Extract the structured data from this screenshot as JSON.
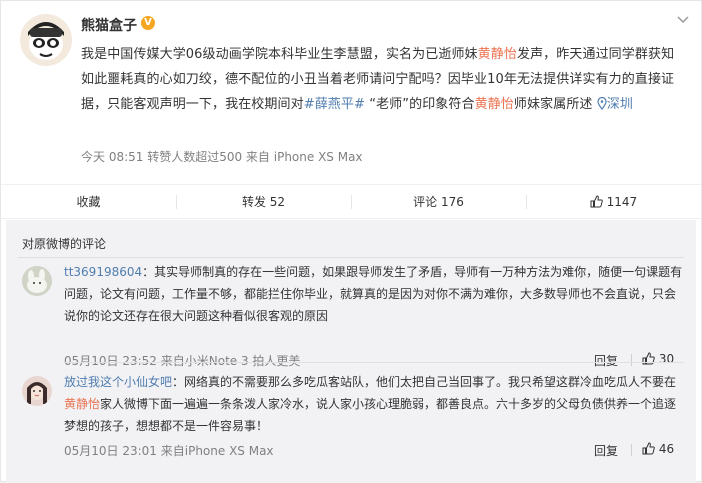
{
  "post": {
    "username": "熊猫盒子",
    "verified_badge": "V",
    "content_parts": {
      "p1": "我是中国传媒大学06级动画学院本科毕业生李慧盟，实名为已逝师妹",
      "h1": "黄静怡",
      "p2": "发声，昨天通过同学群获知如此噩耗真的心如刀绞，德不配位的小丑当着老师请问宁配吗？因毕业10年无法提供详实有力的直接证据，只能客观声明一下，我在校期间对",
      "tag": "#薛燕平#",
      "p3": " “老师”的印象符合",
      "h2": "黄静怡",
      "p4": "师妹家属所述 ",
      "loc": "深圳"
    },
    "meta": "今天 08:51 转赞人数超过500 来自 iPhone XS Max"
  },
  "actions": {
    "favorite": "收藏",
    "repost": "转发 52",
    "comment": "评论 176",
    "like": "1147"
  },
  "comments_section": {
    "title": "对原微博的评论",
    "items": [
      {
        "user": "tt369198604",
        "text": "：其实导师制真的存在一些问题，如果跟导师发生了矛盾，导师有一万种方法为难你，随便一句课题有问题，论文有问题，工作量不够，都能拦住你毕业，就算真的是因为对你不满为难你，大多数导师也不会直说，只会说你的论文还存在很大问题这种看似很客观的原因",
        "meta": "05月10日 23:52 来自小米Note 3 拍人更美",
        "reply": "回复",
        "likes": "30"
      },
      {
        "user": "放过我这个小仙女吧",
        "text_a": "：网络真的不需要那么多吃瓜客站队，他们太把自己当回事了。我只希望这群冷血吃瓜人不要在",
        "text_hl": "黄静怡",
        "text_b": "家人微博下面一遍遍一条条泼人家冷水，说人家小孩心理脆弱，都善良点。六十多岁的父母负债供养一个追逐梦想的孩子，想想都不是一件容易事！",
        "meta": "05月10日 23:01 来自iPhone XS Max",
        "reply": "回复",
        "likes": "46"
      }
    ]
  },
  "colors": {
    "highlight": "#eb7350",
    "link": "#507daf",
    "badge": "#f5a623"
  },
  "icons": {
    "chevron": "chevron-down-icon",
    "location": "location-pin-icon",
    "repost": "repost-icon",
    "comment": "comment-icon",
    "like": "thumbs-up-icon"
  }
}
